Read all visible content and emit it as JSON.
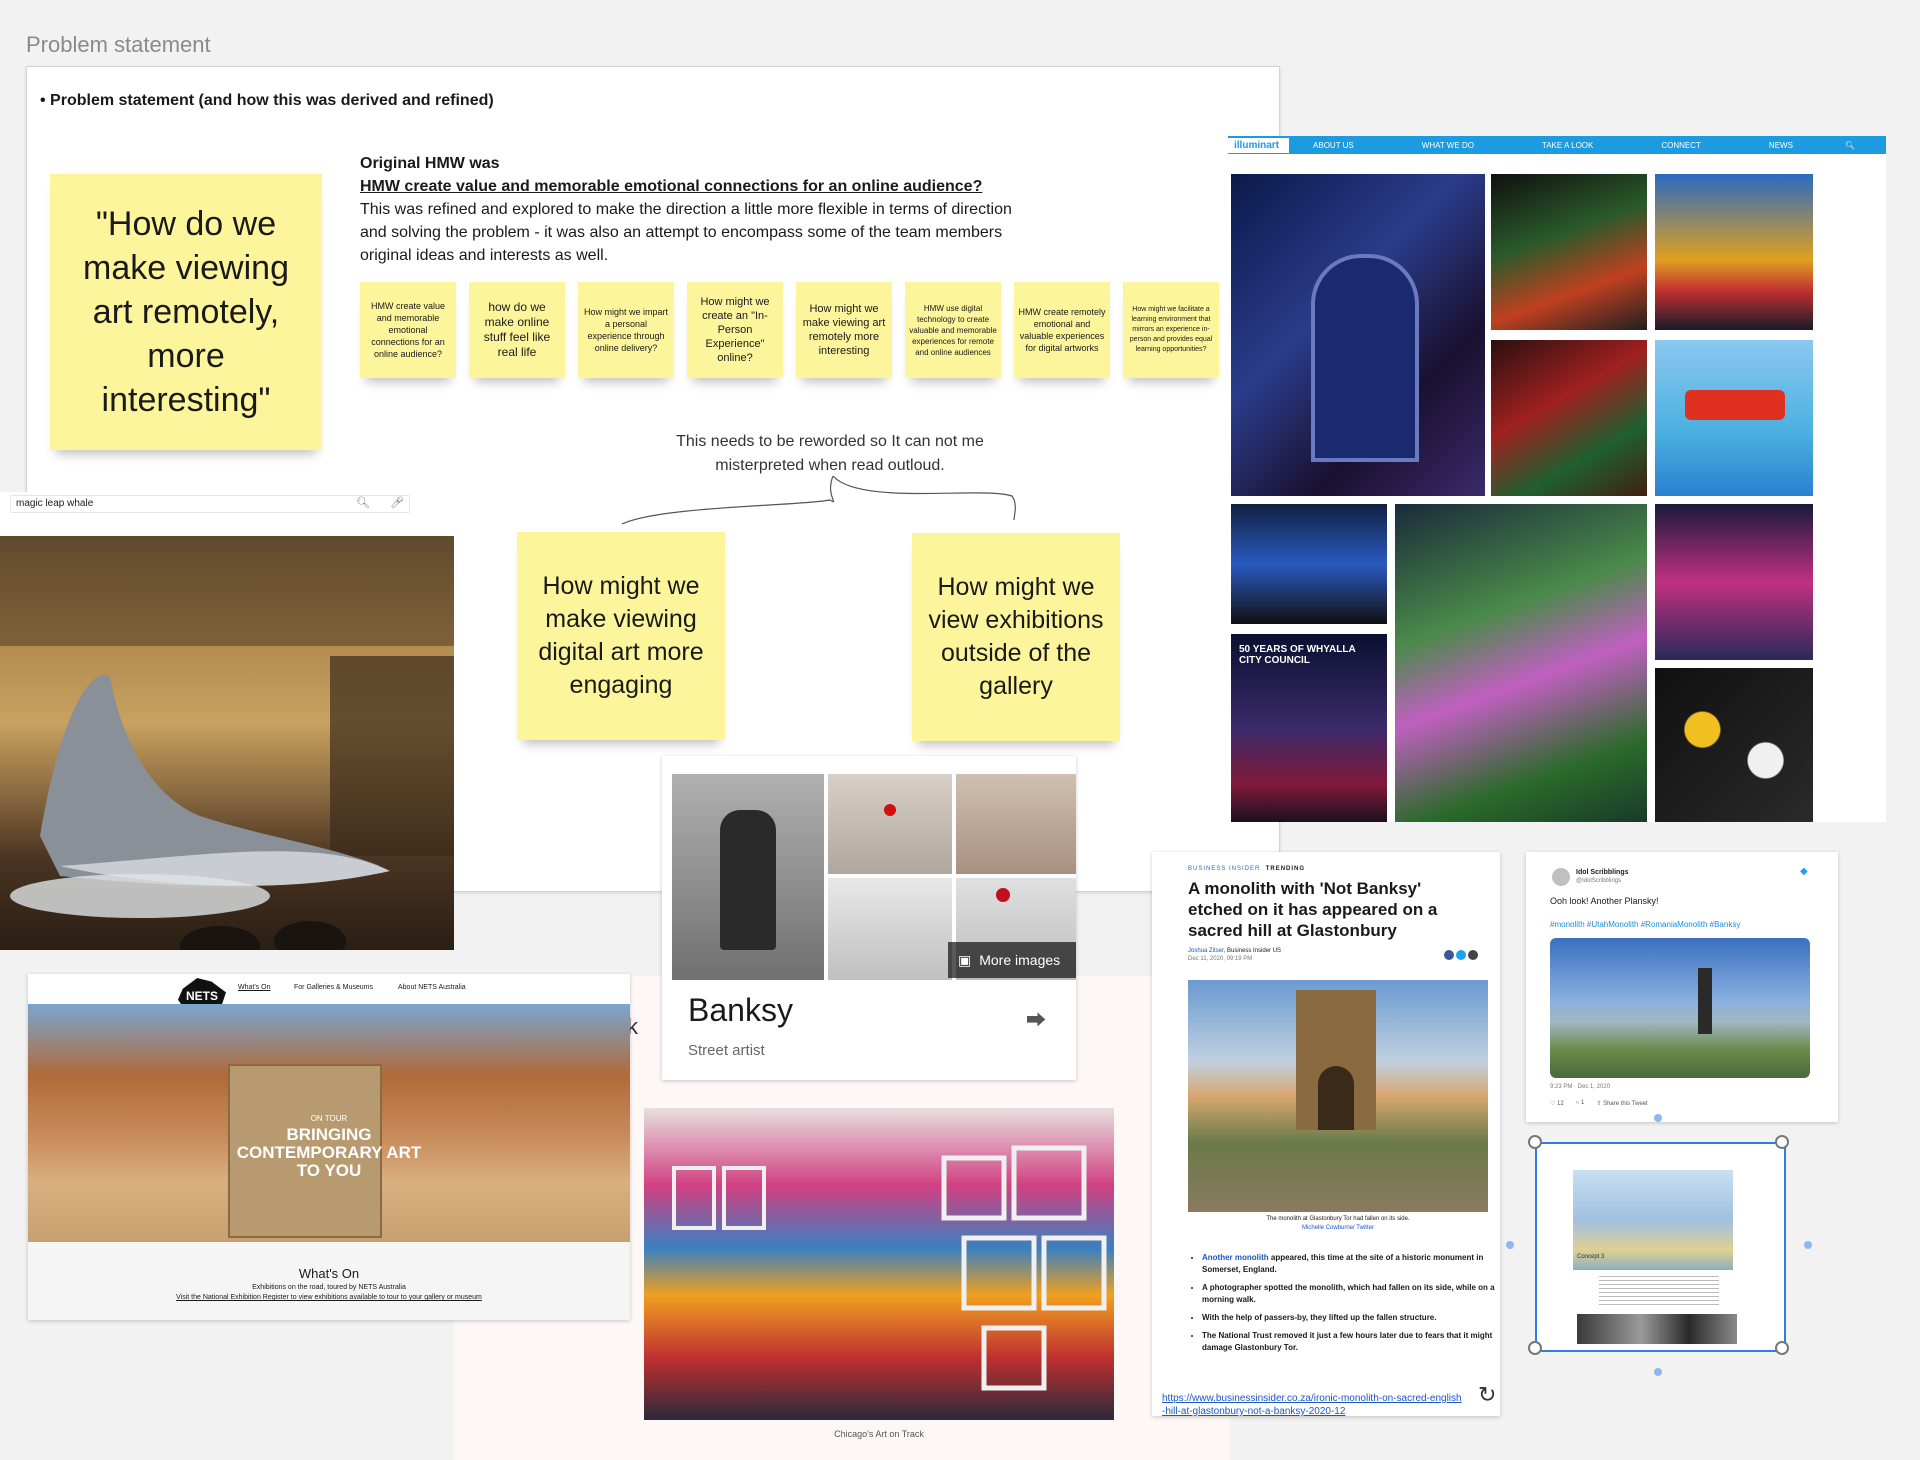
{
  "frame": {
    "title": "Problem statement",
    "heading": "• Problem statement (and how this was derived and refined)"
  },
  "big_sticky": "\"How do we make viewing art remotely, more interesting\"",
  "hmw": {
    "label": "Original HMW was",
    "original": "HMW create value and memorable emotional connections for an online audience?",
    "body": "This was refined and explored to make the direction a little more flexible in terms of direction and solving the problem - it was also an attempt to encompass some of the team members original ideas and interests as well."
  },
  "small_stickies": [
    "HMW create value and memorable emotional connections for an online audience?",
    "how do we make online stuff feel like real life",
    "How might we impart a personal experience through online delivery?",
    "How might we create an \"In-Person Experience\" online?",
    "How might we make viewing art remotely more interesting",
    "HMW use digital technology to create valuable and memorable experiences for remote and online audiences",
    "HMW create remotely emotional and valuable experiences for digital artworks",
    "How might we facilitate a learning environment that mirrors an experience in-person and provides equal learning opportunities?"
  ],
  "note": "This needs to be reworded so It can not me misterpreted when read outloud.",
  "sticky_left": "How might we make viewing digital art more engaging",
  "sticky_right": "How might we view exhibitions outside of the gallery",
  "search": {
    "query": "magic leap whale"
  },
  "illuminart": {
    "logo": "illuminart",
    "nav": [
      "ABOUT US",
      "WHAT WE DO",
      "TAKE A LOOK",
      "CONNECT",
      "NEWS"
    ],
    "tile_text": "50 YEARS OF WHYALLA CITY COUNCIL"
  },
  "nets": {
    "logo": "NETS",
    "nav": [
      "What's On",
      "For Galleries & Museums",
      "About NETS Australia"
    ],
    "tag": "ON TOUR",
    "hero_line1": "BRINGING",
    "hero_line2": "CONTEMPORARY ART",
    "hero_line3": "TO YOU",
    "section_title": "What's On",
    "section_sub": "Exhibitions on the road, toured by NETS Australia",
    "section_link": "Visit the National Exhibition Register to view exhibitions available to tour to your gallery or museum"
  },
  "banksy": {
    "more_images": "More images",
    "name": "Banksy",
    "subtitle": "Street artist"
  },
  "partial_text": "ck",
  "art_track_caption": "Chicago's Art on Track",
  "bi": {
    "brand": "BUSINESS INSIDER",
    "trending": "TRENDING",
    "headline": "A monolith with 'Not Banksy' etched on it has appeared on a sacred hill at Glastonbury",
    "author": "Joshua Zitser",
    "outlet": ", Business Insider US",
    "date": "Dec 11, 2020, 09:19 PM",
    "caption1": "The monolith at Glastonbury Tor had fallen on its side.",
    "caption2": "Michelle Cowburne/ Twitter",
    "bullets": [
      {
        "link": "Another monolith",
        "text": " appeared, this time at the site of a historic monument in Somerset, England."
      },
      {
        "link": "",
        "text": "A photographer spotted the monolith, which had fallen on its side, while on a morning walk."
      },
      {
        "link": "",
        "text": "With the help of passers-by, they lifted up the fallen structure."
      },
      {
        "link": "",
        "text": "The National Trust removed it just a few hours later due to fears that it might damage Glastonbury Tor."
      }
    ],
    "url": "https://www.businessinsider.co.za/ironic-monolith-on-sacred-english-hill-at-glastonbury-not-a-banksy-2020-12"
  },
  "tweet": {
    "name": "Idol Scribblings",
    "handle": "@IdolScribblings",
    "text": "Ooh look! Another Plansky!",
    "tags": "#monolith #UtahMonolith #RomaniaMonolith #Banksy",
    "time": "9:23 PM · Dec 1, 2020",
    "likes": "12",
    "replies": "1",
    "share": "Share this Tweet"
  },
  "selected_card": {
    "title": "Concept 3"
  },
  "colors": {
    "sticky": "#fdf59b",
    "illuminart_nav": "#1c9be0",
    "selection": "#2b7de9",
    "link": "#1a56c4"
  }
}
